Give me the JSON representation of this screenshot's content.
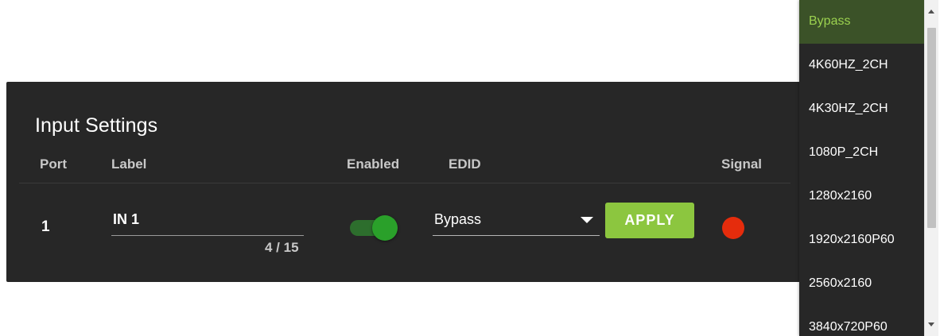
{
  "panel": {
    "title": "Input Settings",
    "columns": {
      "port": "Port",
      "label": "Label",
      "enabled": "Enabled",
      "edid": "EDID",
      "signal": "Signal"
    },
    "row": {
      "port": "1",
      "label_value": "IN 1",
      "char_count": "4 / 15",
      "enabled": true,
      "edid_value": "Bypass",
      "apply_label": "APPLY",
      "signal_color": "#e52c0c"
    }
  },
  "dropdown": {
    "selected": "Bypass",
    "options": [
      "Bypass",
      "4K60HZ_2CH",
      "4K30HZ_2CH",
      "1080P_2CH",
      "1280x2160",
      "1920x2160P60",
      "2560x2160",
      "3840x720P60"
    ]
  },
  "colors": {
    "panel_bg": "#272727",
    "accent_green": "#8cc63f",
    "toggle_on": "#2aa02a",
    "selected_text": "#9bd14f",
    "signal_off": "#e52c0c"
  }
}
